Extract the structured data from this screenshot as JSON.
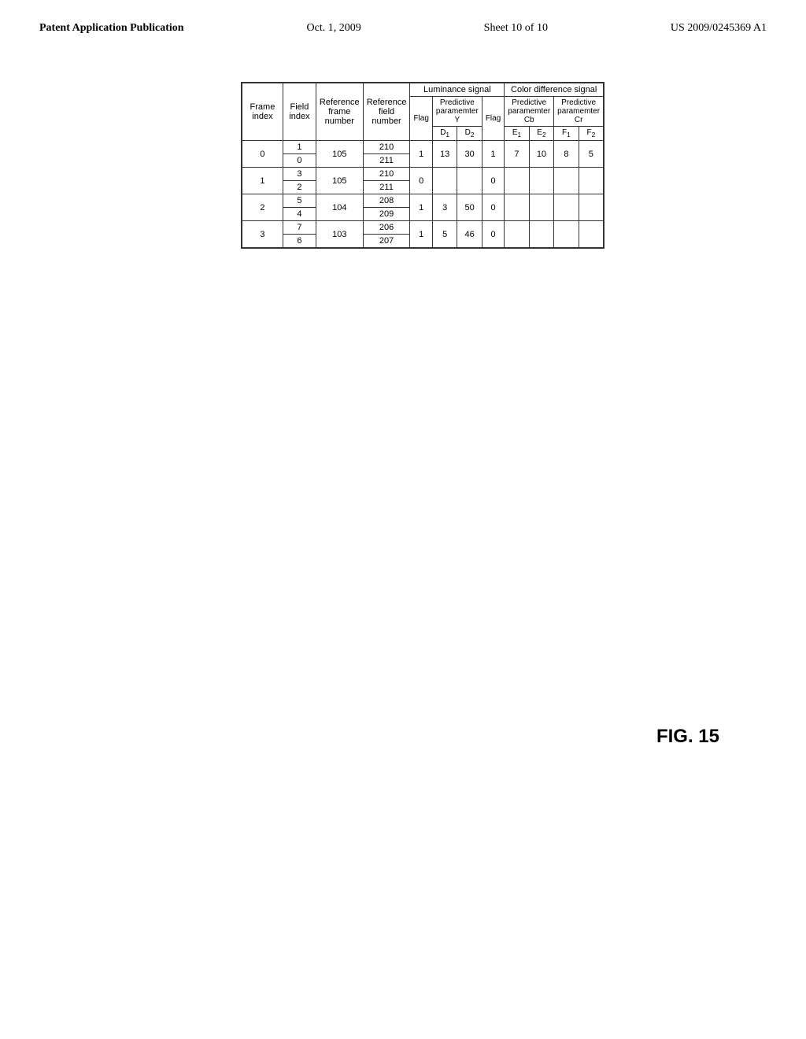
{
  "header": {
    "left": "Patent Application Publication",
    "center": "Oct. 1, 2009",
    "sheet": "Sheet 10 of 10",
    "right": "US 2009/0245369 A1"
  },
  "fig_label": "FIG. 15",
  "table": {
    "top_headers": {
      "luminance": "Luminance signal",
      "color_diff": "Color difference signal"
    },
    "columns": {
      "frame_index": "Frame index",
      "field_index": "Field index",
      "ref_frame": "Reference\nframe number",
      "ref_field": "Reference\nfield number",
      "lum_flag": "Flag",
      "lum_d1": "D₁",
      "lum_d2": "D₂",
      "color_flag": "Flag",
      "color_e1": "E₁",
      "color_e2": "E₂",
      "color_f1": "F₁",
      "color_f2": "F₂",
      "lum_pred_label": "Predictive\nparamemter Y",
      "color_cb_pred_label": "Predictive\nparamemter Cb",
      "color_cr_pred_label": "Predictive\nparamemter Cr"
    },
    "rows": [
      {
        "frame_index": "0",
        "field_index_1": "1",
        "field_index_2": "0",
        "ref_frame": "105",
        "ref_field_1": "210",
        "ref_field_2": "211",
        "lum_flag": "1",
        "lum_d1": "13",
        "lum_d2": "30",
        "color_flag": "1",
        "color_e1": "7",
        "color_e2": "10",
        "color_f1": "8",
        "color_f2": "5"
      },
      {
        "frame_index": "1",
        "field_index_1": "3",
        "field_index_2": "2",
        "ref_frame": "105",
        "ref_field_1": "210",
        "ref_field_2": "211",
        "lum_flag": "0",
        "lum_d1": "",
        "lum_d2": "",
        "color_flag": "0",
        "color_e1": "",
        "color_e2": "",
        "color_f1": "",
        "color_f2": ""
      },
      {
        "frame_index": "2",
        "field_index_1": "5",
        "field_index_2": "4",
        "ref_frame": "104",
        "ref_field_1": "208",
        "ref_field_2": "209",
        "lum_flag": "1",
        "lum_d1": "3",
        "lum_d2": "50",
        "color_flag": "0",
        "color_e1": "",
        "color_e2": "",
        "color_f1": "",
        "color_f2": ""
      },
      {
        "frame_index": "3",
        "field_index_1": "7",
        "field_index_2": "6",
        "ref_frame": "103",
        "ref_field_1": "206",
        "ref_field_2": "207",
        "lum_flag": "1",
        "lum_d1": "5",
        "lum_d2": "46",
        "color_flag": "0",
        "color_e1": "",
        "color_e2": "",
        "color_f1": "",
        "color_f2": ""
      }
    ]
  }
}
